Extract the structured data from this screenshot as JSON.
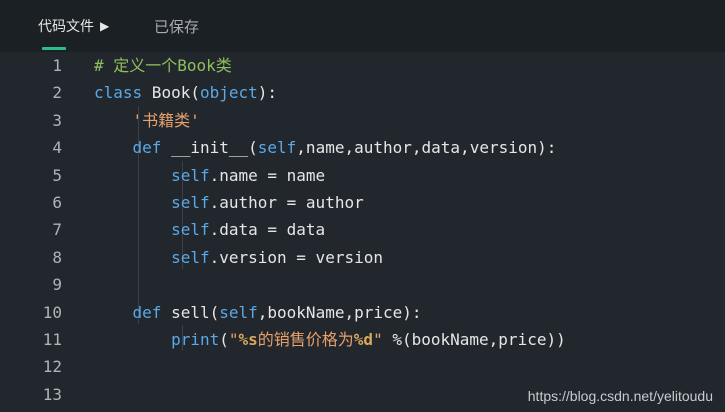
{
  "header": {
    "file_tab": "代码文件",
    "caret": "▶",
    "status": "已保存"
  },
  "editor": {
    "line_numbers": [
      "1",
      "2",
      "3",
      "4",
      "5",
      "6",
      "7",
      "8",
      "9",
      "10",
      "11",
      "12",
      "13"
    ],
    "lines": [
      [
        {
          "t": "comment",
          "v": "# 定义一个Book类"
        }
      ],
      [
        {
          "t": "keyword",
          "v": "class"
        },
        {
          "t": "plain",
          "v": " Book("
        },
        {
          "t": "keyword",
          "v": "object"
        },
        {
          "t": "plain",
          "v": "):"
        }
      ],
      [
        {
          "t": "plain",
          "v": "    "
        },
        {
          "t": "string",
          "v": "'书籍类'"
        }
      ],
      [
        {
          "t": "plain",
          "v": "    "
        },
        {
          "t": "keyword",
          "v": "def"
        },
        {
          "t": "plain",
          "v": " __init__("
        },
        {
          "t": "self",
          "v": "self"
        },
        {
          "t": "plain",
          "v": ",name,author,data,version):"
        }
      ],
      [
        {
          "t": "plain",
          "v": "        "
        },
        {
          "t": "self",
          "v": "self"
        },
        {
          "t": "plain",
          "v": ".name = name"
        }
      ],
      [
        {
          "t": "plain",
          "v": "        "
        },
        {
          "t": "self",
          "v": "self"
        },
        {
          "t": "plain",
          "v": ".author = author"
        }
      ],
      [
        {
          "t": "plain",
          "v": "        "
        },
        {
          "t": "self",
          "v": "self"
        },
        {
          "t": "plain",
          "v": ".data = data"
        }
      ],
      [
        {
          "t": "plain",
          "v": "        "
        },
        {
          "t": "self",
          "v": "self"
        },
        {
          "t": "plain",
          "v": ".version = version"
        }
      ],
      [],
      [
        {
          "t": "plain",
          "v": "    "
        },
        {
          "t": "keyword",
          "v": "def"
        },
        {
          "t": "plain",
          "v": " sell("
        },
        {
          "t": "self",
          "v": "self"
        },
        {
          "t": "plain",
          "v": ",bookName,price):"
        }
      ],
      [
        {
          "t": "plain",
          "v": "        "
        },
        {
          "t": "keyword",
          "v": "print"
        },
        {
          "t": "plain",
          "v": "("
        },
        {
          "t": "string",
          "v": "\""
        },
        {
          "t": "fmt",
          "v": "%s"
        },
        {
          "t": "string",
          "v": "的销售价格为"
        },
        {
          "t": "fmt",
          "v": "%d"
        },
        {
          "t": "string",
          "v": "\""
        },
        {
          "t": "plain",
          "v": " %(bookName,price))"
        }
      ],
      [],
      []
    ]
  },
  "watermark": "https://blog.csdn.net/yelitoudu",
  "colors": {
    "background": "#22272e",
    "keyword": "#5ba8e6",
    "comment": "#8fbf5a",
    "string": "#e6a06b",
    "accent": "#2bbd8a"
  }
}
